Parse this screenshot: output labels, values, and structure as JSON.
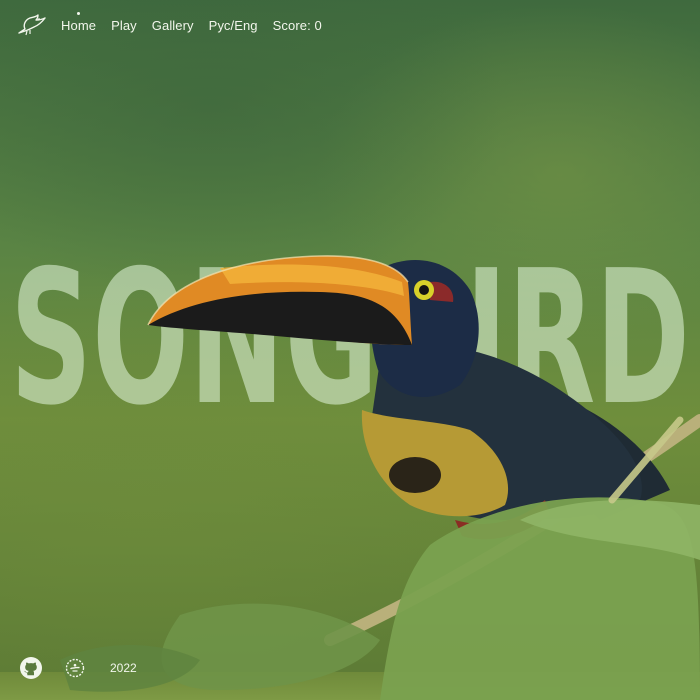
{
  "nav": {
    "logo_icon": "bird-icon",
    "items": [
      {
        "label": "Home",
        "active": true
      },
      {
        "label": "Play",
        "active": false
      },
      {
        "label": "Gallery",
        "active": false
      },
      {
        "label": "Рус/Eng",
        "active": false
      }
    ],
    "score_label": "Score: 0"
  },
  "hero": {
    "headline": "SONGBIRD"
  },
  "footer": {
    "github_icon": "github-icon",
    "school_icon": "rs-school-icon",
    "year": "2022"
  },
  "colors": {
    "text": "#f2f6ec",
    "background_green": "#5a8444",
    "headline_fill": "rgba(214,236,205,0.62)"
  }
}
